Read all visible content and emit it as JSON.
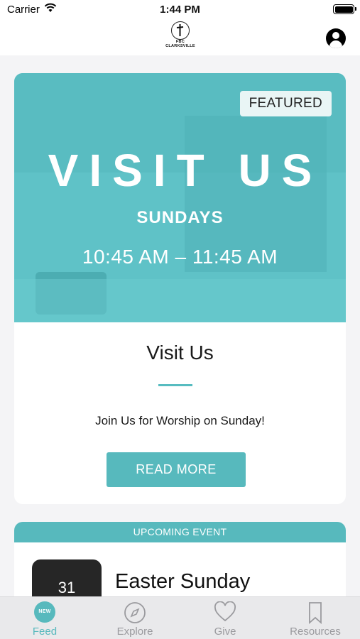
{
  "status_bar": {
    "carrier": "Carrier",
    "time": "1:44 PM"
  },
  "header": {
    "logo_line1": "FBC",
    "logo_line2": "CLARKSVILLE"
  },
  "featured": {
    "badge": "FEATURED",
    "hero_title": "VISIT US",
    "hero_subtitle": "SUNDAYS",
    "hero_time": "10:45 AM – 11:45 AM",
    "title": "Visit Us",
    "description": "Join Us for Worship on Sunday!",
    "button_label": "READ MORE"
  },
  "event": {
    "header": "UPCOMING EVENT",
    "date_day": "31",
    "title": "Easter Sunday"
  },
  "tabs": [
    {
      "label": "Feed",
      "icon": "new-badge-icon",
      "badge": "NEW",
      "active": true
    },
    {
      "label": "Explore",
      "icon": "compass-icon",
      "active": false
    },
    {
      "label": "Give",
      "icon": "heart-icon",
      "active": false
    },
    {
      "label": "Resources",
      "icon": "bookmark-icon",
      "active": false
    }
  ],
  "colors": {
    "accent": "#57b9bd",
    "hero": "#5fc2c7",
    "date_box": "#262626"
  }
}
